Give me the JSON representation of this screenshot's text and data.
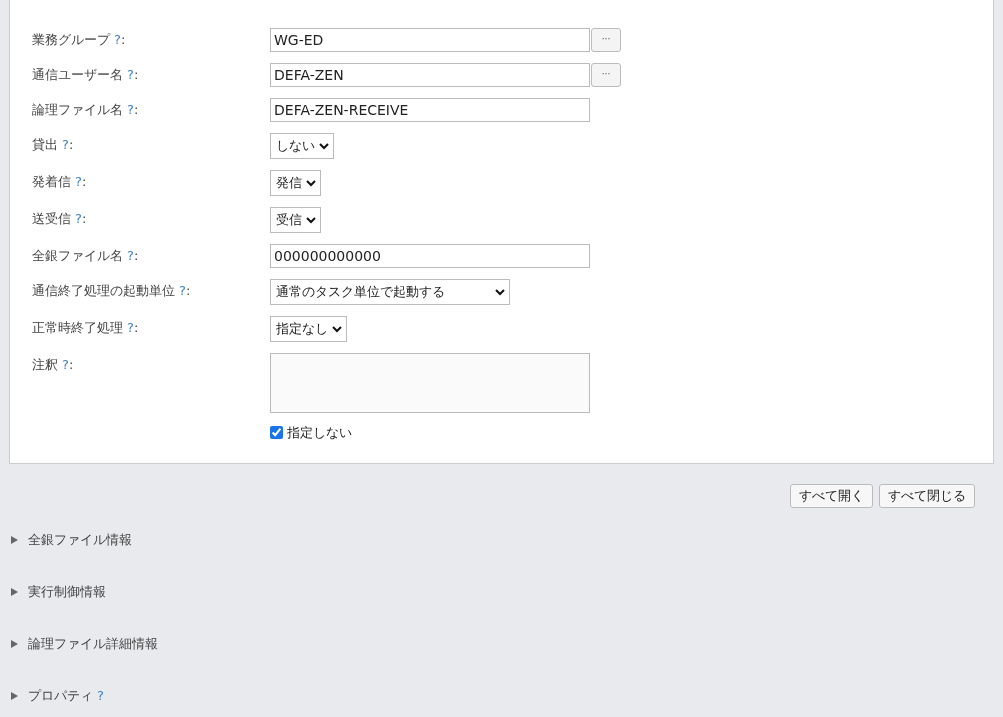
{
  "fields": [
    {
      "kind": "text",
      "label": "業務グループ",
      "help": "?",
      "suffix": ":",
      "value": "WG-ED",
      "browse": "···"
    },
    {
      "kind": "text",
      "label": "通信ユーザー名",
      "help": "?",
      "suffix": ":",
      "value": "DEFA-ZEN",
      "browse": "···"
    },
    {
      "kind": "text",
      "label": "論理ファイル名",
      "help": "?",
      "suffix": ":",
      "value": "DEFA-ZEN-RECEIVE"
    },
    {
      "kind": "select",
      "label": "貸出",
      "help": "?",
      "suffix": ":",
      "value": "しない"
    },
    {
      "kind": "select",
      "label": "発着信",
      "help": "?",
      "suffix": ":",
      "value": "発信"
    },
    {
      "kind": "select",
      "label": "送受信",
      "help": "?",
      "suffix": ":",
      "value": "受信"
    },
    {
      "kind": "text",
      "label": "全銀ファイル名",
      "help": "?",
      "suffix": ":",
      "value": "000000000000"
    },
    {
      "kind": "wideselect",
      "label": "通信終了処理の起動単位",
      "help": "?",
      "suffix": ":",
      "value": "通常のタスク単位で起動する"
    },
    {
      "kind": "select",
      "label": "正常時終了処理",
      "help": "?",
      "suffix": ":",
      "value": "指定なし"
    },
    {
      "kind": "textarea",
      "label": "注釈",
      "help": "?",
      "suffix": ":",
      "checkbox": {
        "label": "指定しない",
        "checked": true
      }
    }
  ],
  "buttons": [
    "すべて開く",
    "すべて閉じる"
  ],
  "sections": [
    {
      "title": "全銀ファイル情報",
      "expanded": false
    },
    {
      "title": "実行制御情報",
      "expanded": false
    },
    {
      "title": "論理ファイル詳細情報",
      "expanded": false
    },
    {
      "title": "プロパティ",
      "help": "?",
      "expanded": false
    }
  ]
}
